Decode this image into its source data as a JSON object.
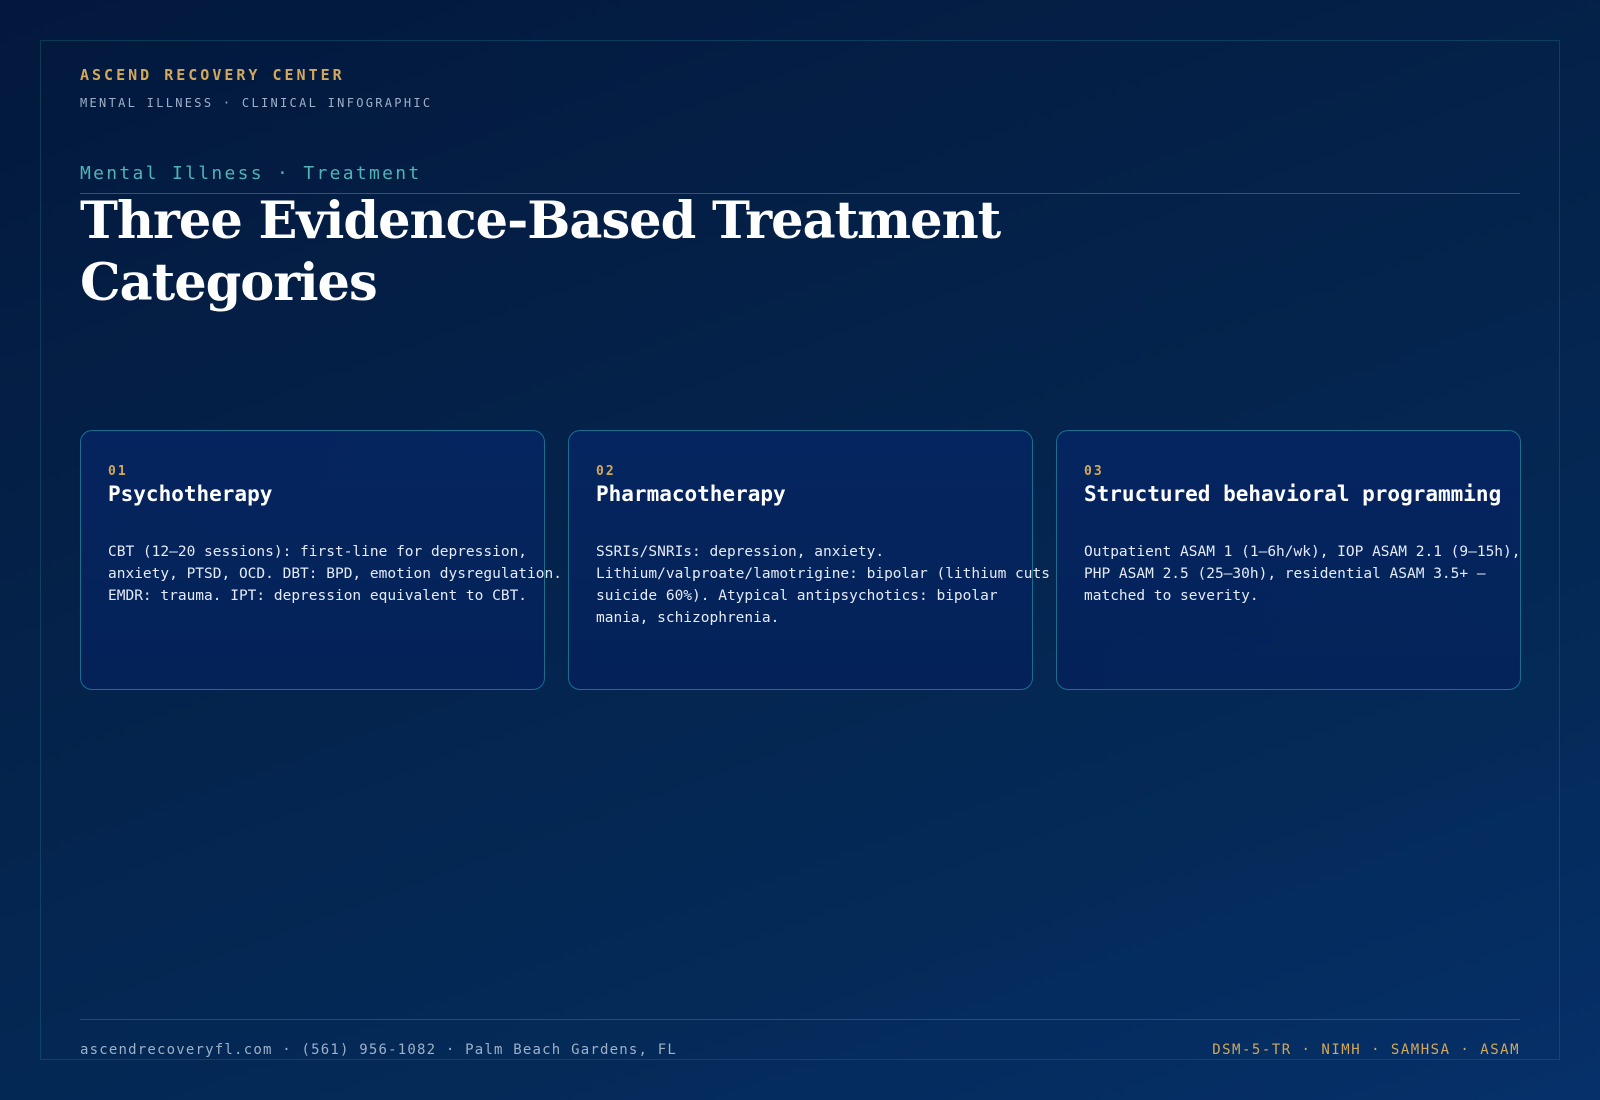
{
  "header": {
    "brand_name": "ASCEND RECOVERY CENTER",
    "brand_sub": "MENTAL ILLNESS · CLINICAL INFOGRAPHIC",
    "eyebrow": "Mental Illness · Treatment",
    "title": "Three Evidence-Based Treatment Categories"
  },
  "cards": [
    {
      "number": "01",
      "title": "Psychotherapy",
      "body": "CBT (12–20 sessions): first-line for depression, anxiety, PTSD, OCD. DBT: BPD, emotion dysregulation. EMDR: trauma. IPT: depression equivalent to CBT."
    },
    {
      "number": "02",
      "title": "Pharmacotherapy",
      "body": "SSRIs/SNRIs: depression, anxiety. Lithium/valproate/lamotrigine: bipolar (lithium cuts suicide 60%). Atypical antipsychotics: bipolar mania, schizophrenia."
    },
    {
      "number": "03",
      "title": "Structured behavioral programming",
      "body": "Outpatient ASAM 1 (1–6h/wk), IOP ASAM 2.1 (9–15h), PHP ASAM 2.5 (25–30h), residential ASAM 3.5+ — matched to severity."
    }
  ],
  "footer": {
    "contact": "ascendrecoveryfl.com · (561) 956-1082 · Palm Beach Gardens, FL",
    "sources": "DSM-5-TR · NIMH · SAMHSA · ASAM"
  },
  "colors": {
    "accent_gold": "#d4a85a",
    "accent_teal": "#4fb3b8",
    "background": "#03183d"
  }
}
